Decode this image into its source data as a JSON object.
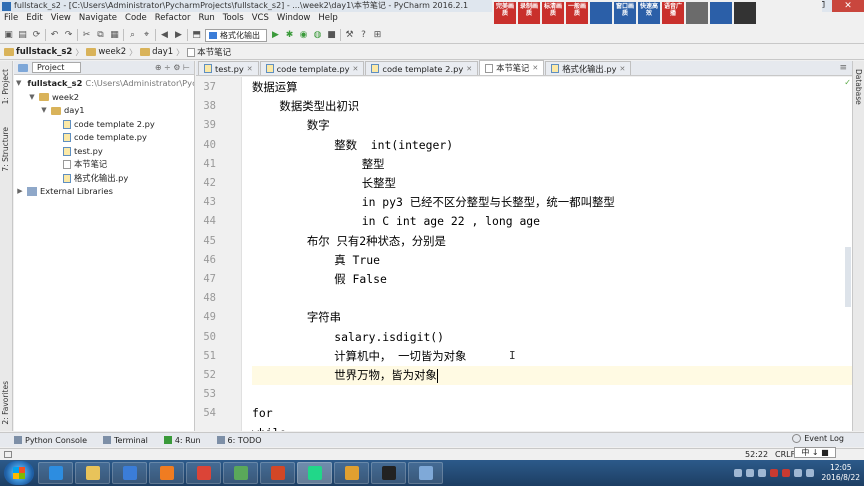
{
  "window": {
    "title": "fullstack_s2 - [C:\\Users\\Administrator\\PycharmProjects\\fullstack_s2] - ...\\week2\\day1\\本节笔记 - PyCharm 2016.2.1",
    "controls": [
      "–",
      "❐",
      "✕"
    ]
  },
  "menu": [
    "File",
    "Edit",
    "View",
    "Navigate",
    "Code",
    "Refactor",
    "Run",
    "Tools",
    "VCS",
    "Window",
    "Help"
  ],
  "ads": [
    {
      "label": "完美画质",
      "color": "#c9302c"
    },
    {
      "label": "录制画质",
      "color": "#c9302c"
    },
    {
      "label": "标清画质",
      "color": "#c9302c"
    },
    {
      "label": "一般画质",
      "color": "#c9302c"
    },
    {
      "label": "",
      "color": "#2b5fa8"
    },
    {
      "label": "窗口画质",
      "color": "#2b5fa8"
    },
    {
      "label": "快速高效",
      "color": "#2b5fa8"
    },
    {
      "label": "语音广播",
      "color": "#c9302c"
    },
    {
      "label": "",
      "color": "#6b6b6b"
    },
    {
      "label": "",
      "color": "#2b5fa8"
    },
    {
      "label": "",
      "color": "#333333"
    }
  ],
  "toolbar": {
    "run_config": "格式化输出"
  },
  "breadcrumb": [
    "fullstack_s2",
    "week2",
    "day1",
    "本节笔记"
  ],
  "project_panel": {
    "header": "Project",
    "tree": [
      {
        "label": "fullstack_s2",
        "path": "C:\\Users\\Administrator\\Pycha",
        "type": "folder",
        "depth": 0,
        "arrow": "▼"
      },
      {
        "label": "week2",
        "path": "",
        "type": "folder",
        "depth": 1,
        "arrow": "▼"
      },
      {
        "label": "day1",
        "path": "",
        "type": "folder",
        "depth": 2,
        "arrow": "▼"
      },
      {
        "label": "code template 2.py",
        "path": "",
        "type": "py",
        "depth": 3,
        "arrow": ""
      },
      {
        "label": "code template.py",
        "path": "",
        "type": "py",
        "depth": 3,
        "arrow": ""
      },
      {
        "label": "test.py",
        "path": "",
        "type": "py",
        "depth": 3,
        "arrow": ""
      },
      {
        "label": "本节笔记",
        "path": "",
        "type": "txt",
        "depth": 3,
        "arrow": ""
      },
      {
        "label": "格式化输出.py",
        "path": "",
        "type": "py",
        "depth": 3,
        "arrow": ""
      },
      {
        "label": "External Libraries",
        "path": "",
        "type": "lib",
        "depth": 0,
        "arrow": "▶"
      }
    ]
  },
  "side_tabs": {
    "project": "1: Project",
    "structure": "7: Structure",
    "favorites": "2: Favorites",
    "database": "Database"
  },
  "tabs": [
    {
      "label": "test.py",
      "active": false
    },
    {
      "label": "code template.py",
      "active": false
    },
    {
      "label": "code template 2.py",
      "active": false
    },
    {
      "label": "本节笔记",
      "active": true
    },
    {
      "label": "格式化输出.py",
      "active": false
    }
  ],
  "editor": {
    "lines": [
      {
        "num": "37",
        "text": "数据运算",
        "indent": 0
      },
      {
        "num": "38",
        "text": "    数据类型出初识",
        "indent": 0
      },
      {
        "num": "39",
        "text": "        数字",
        "indent": 0
      },
      {
        "num": "40",
        "text": "            整数  int(integer)",
        "indent": 0
      },
      {
        "num": "41",
        "text": "                整型",
        "indent": 0
      },
      {
        "num": "42",
        "text": "                长整型",
        "indent": 0
      },
      {
        "num": "43",
        "text": "                in py3 已经不区分整型与长整型，统一都叫整型",
        "indent": 0
      },
      {
        "num": "44",
        "text": "                in C int age 22 , long age",
        "indent": 0
      },
      {
        "num": "45",
        "text": "        布尔 只有2种状态，分别是",
        "indent": 0
      },
      {
        "num": "46",
        "text": "            真 True",
        "indent": 0
      },
      {
        "num": "47",
        "text": "            假 False",
        "indent": 0
      },
      {
        "num": "48",
        "text": "",
        "indent": 0
      },
      {
        "num": "49",
        "text": "        字符串",
        "indent": 0
      },
      {
        "num": "50",
        "text": "            salary.isdigit()",
        "indent": 0
      },
      {
        "num": "51",
        "text": "            计算机中， 一切皆为对象",
        "indent": 0
      },
      {
        "num": "52",
        "text": "            世界万物，皆为对象",
        "indent": 0
      },
      {
        "num": "53",
        "text": "",
        "indent": 0
      },
      {
        "num": "54",
        "text": "for",
        "indent": 0
      },
      {
        "num": "",
        "text": "while",
        "indent": 0
      }
    ],
    "current_line": "52"
  },
  "bottom_tabs": [
    {
      "label": "Python Console",
      "kind": "console"
    },
    {
      "label": "Terminal",
      "kind": "terminal"
    },
    {
      "label": "4: Run",
      "kind": "run"
    },
    {
      "label": "6: TODO",
      "kind": "todo"
    }
  ],
  "event_log": "Event Log",
  "status": {
    "position": "52:22",
    "line_sep": "CRLF÷",
    "encoding": "UTF"
  },
  "ime": "中 ↓ ■",
  "taskbar": {
    "apps": [
      "ie",
      "explorer",
      "search",
      "media",
      "chrome",
      "charts",
      "presentation",
      "pycharm",
      "people",
      "terminal",
      "app"
    ],
    "active_app": 7,
    "time": "12:05",
    "date": "2016/8/22"
  }
}
